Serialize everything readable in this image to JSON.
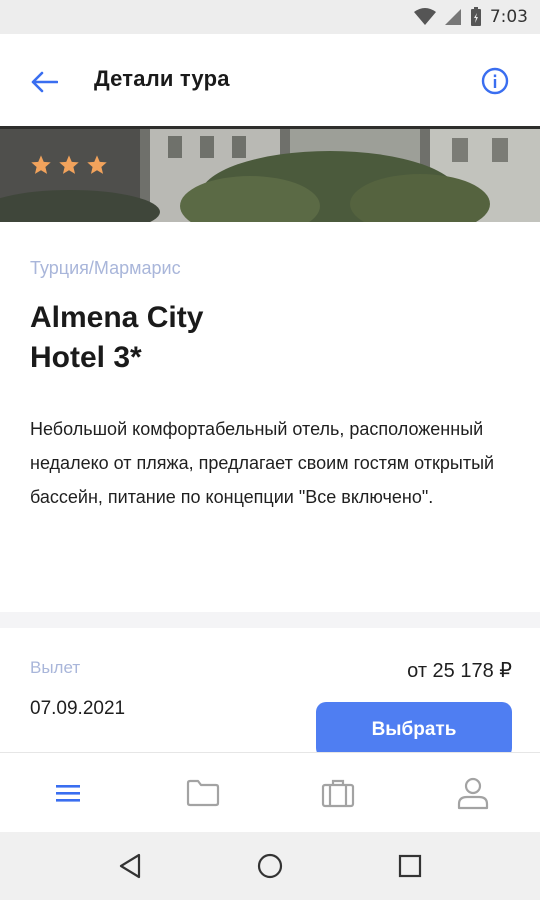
{
  "status_bar": {
    "time": "7:03"
  },
  "app_bar": {
    "title": "Детали тура"
  },
  "hero": {
    "star_count": 3,
    "star_color": "#f2a35c"
  },
  "hotel": {
    "location": "Турция/Мармарис",
    "name_line1": "Almena City",
    "name_line2": "Hotel 3*",
    "description": "Небольшой комфортабельный отель, расположенный недалеко от пляжа, предлагает своим гостям открытый бассейн, питание по концепции \"Все включено\"."
  },
  "departure": {
    "label": "Вылет",
    "date": "07.09.2021",
    "price": "от 25 178 ₽",
    "select_label": "Выбрать"
  },
  "bottom_nav": {
    "items": [
      {
        "icon": "menu-icon",
        "active": true
      },
      {
        "icon": "folder-icon",
        "active": false
      },
      {
        "icon": "briefcase-icon",
        "active": false
      },
      {
        "icon": "profile-icon",
        "active": false
      }
    ]
  },
  "colors": {
    "accent": "#4f7ef2",
    "muted_label": "#a9b6da",
    "star": "#f2a35c"
  }
}
